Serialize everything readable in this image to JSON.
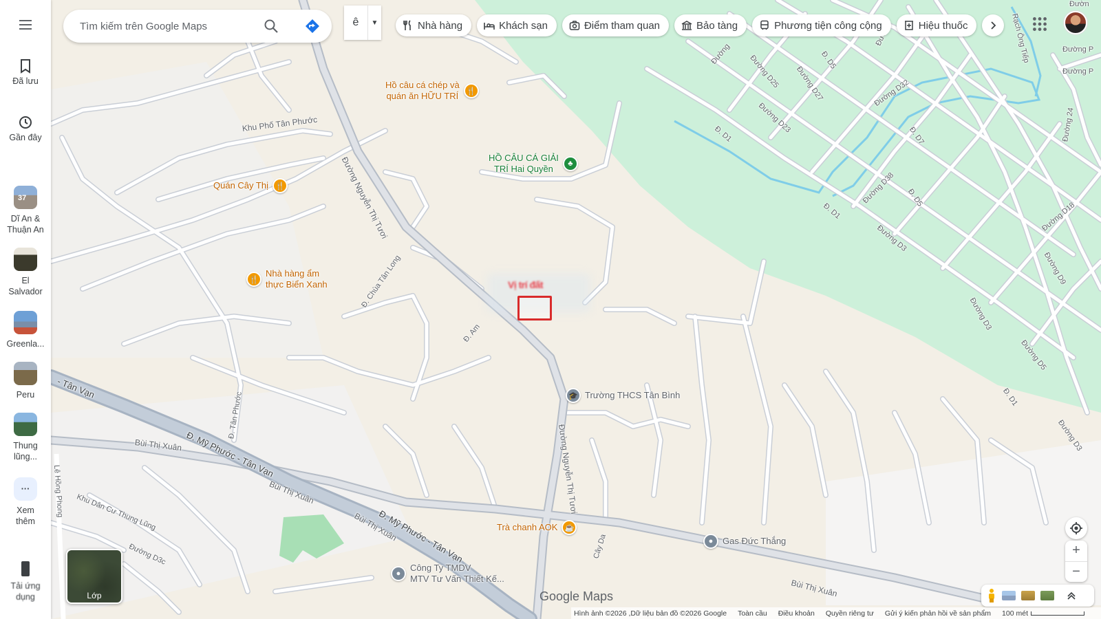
{
  "search": {
    "placeholder": "Tìm kiếm trên Google Maps"
  },
  "ime": {
    "char": "ê"
  },
  "rail": {
    "menu_icon": "hamburger-icon",
    "saved_label": "Đã lưu",
    "recent_label": "Gần đây",
    "recent_places": [
      {
        "label": "Dĩ An &\nThuận An",
        "badge": "37"
      },
      {
        "label": "El\nSalvador"
      },
      {
        "label": "Greenla..."
      },
      {
        "label": "Peru"
      },
      {
        "label": "Thung\nlũng..."
      }
    ],
    "more_label": "Xem\nthêm",
    "bottom_label": "Tải ứng\ndụng"
  },
  "chips": [
    {
      "label": "Nhà hàng",
      "icon": "restaurant-icon"
    },
    {
      "label": "Khách sạn",
      "icon": "hotel-icon"
    },
    {
      "label": "Điểm tham quan",
      "icon": "camera-icon"
    },
    {
      "label": "Bảo tàng",
      "icon": "museum-icon"
    },
    {
      "label": "Phương tiện công cộng",
      "icon": "transit-icon"
    },
    {
      "label": "Hiệu thuốc",
      "icon": "pharmacy-icon"
    }
  ],
  "map": {
    "marker_label": "Vị trí đất",
    "pois": [
      {
        "name": "Hồ câu cá chép và\nquán ăn HỮU TRÍ",
        "type": "food"
      },
      {
        "name": "HỒ CÂU CÁ GIẢI\nTRÍ Hai Quyền",
        "type": "park"
      },
      {
        "name": "Quán Cây Thị",
        "type": "food"
      },
      {
        "name": "Nhà hàng ẩm\nthực Biển Xanh",
        "type": "food"
      },
      {
        "name": "Trường THCS Tân Bình",
        "type": "grey"
      },
      {
        "name": "Trà chanh AOK",
        "type": "food"
      },
      {
        "name": "Gas Đức Thắng",
        "type": "grey"
      },
      {
        "name": "Công Ty TMDV\nMTV Tư Vấn Thiết Kế...",
        "type": "grey"
      }
    ],
    "roads": [
      "Khu Phố Tân Phước",
      "Đường Nguyễn Thị Tươi",
      "Đ. Chùa Tân Long",
      "Đ. Am",
      "Đ. Tân Phước",
      "Đường Nguyễn Thị Tươi",
      "- Tân Vạn",
      "Đ. Mỹ Phước - Tân Vạn",
      "Bùi Thị Xuân",
      "Bùi Thị Xuân",
      "Bùi Thị Xuân",
      "Đ. Mỹ Phước - Tân Vạn",
      "Lê Hồng Phong",
      "Khu Dân Cư Thung Lũng",
      "Đường D3c",
      "Cây Da",
      "Bùi Thị Xuân",
      "Đường D25",
      "Đường D27",
      "Đường D23",
      "Đ. D1",
      "Đ. D5",
      "Đường D32",
      "Đ. D7",
      "Đường D38",
      "Đ. D5",
      "Đ. D1",
      "Đường D3",
      "Đường D18",
      "Đường D9",
      "Đường D3",
      "Đường D5",
      "Đ. D1",
      "Đường D3",
      "Đường 24",
      "Rạch Ông Tiếp",
      "Đường",
      "Đường",
      "Đường P",
      "Đường P",
      "Đườn"
    ]
  },
  "controls": {
    "layer_label": "Lớp"
  },
  "branding": {
    "logo": "Google Maps"
  },
  "footer": {
    "imagery": "Hình ảnh ©2026 ,Dữ liệu bản đồ ©2026 Google",
    "global": "Toàn cầu",
    "terms": "Điều khoản",
    "privacy": "Quyền riêng tư",
    "feedback": "Gửi ý kiến phản hồi về sản phẩm",
    "scale": "100 mét"
  }
}
